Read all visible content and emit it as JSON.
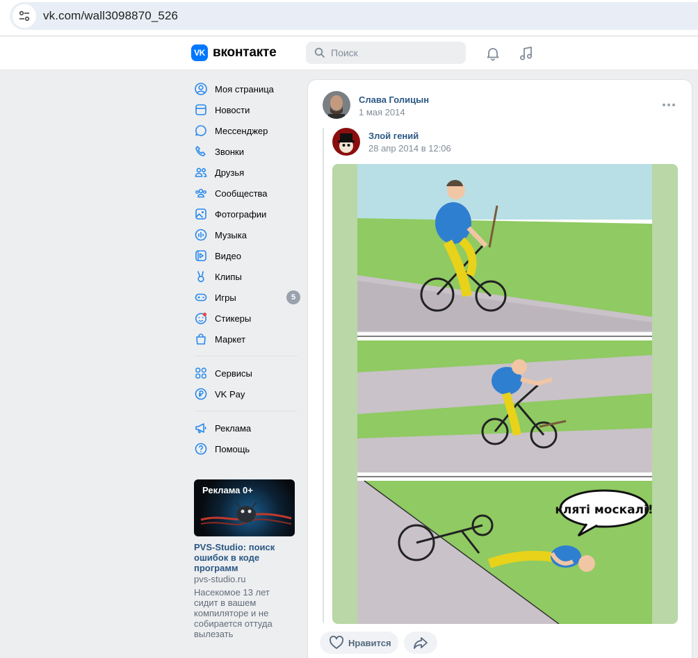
{
  "browser": {
    "url": "vk.com/wall3098870_526"
  },
  "header": {
    "logo_text": "вконтакте",
    "logo_mark": "VK",
    "search_placeholder": "Поиск"
  },
  "nav": {
    "items": [
      {
        "label": "Моя страница",
        "icon": "user-circle-icon"
      },
      {
        "label": "Новости",
        "icon": "news-icon"
      },
      {
        "label": "Мессенджер",
        "icon": "message-icon"
      },
      {
        "label": "Звонки",
        "icon": "phone-icon"
      },
      {
        "label": "Друзья",
        "icon": "friends-icon"
      },
      {
        "label": "Сообщества",
        "icon": "communities-icon"
      },
      {
        "label": "Фотографии",
        "icon": "photo-icon"
      },
      {
        "label": "Музыка",
        "icon": "music-icon"
      },
      {
        "label": "Видео",
        "icon": "video-icon"
      },
      {
        "label": "Клипы",
        "icon": "clips-icon"
      },
      {
        "label": "Игры",
        "icon": "games-icon",
        "badge": "5"
      },
      {
        "label": "Стикеры",
        "icon": "stickers-icon"
      },
      {
        "label": "Маркет",
        "icon": "market-icon"
      }
    ],
    "items2": [
      {
        "label": "Сервисы",
        "icon": "services-icon"
      },
      {
        "label": "VK Pay",
        "icon": "vkpay-icon"
      }
    ],
    "items3": [
      {
        "label": "Реклама",
        "icon": "megaphone-icon"
      },
      {
        "label": "Помощь",
        "icon": "help-icon"
      }
    ]
  },
  "ad": {
    "image_label": "Реклама 0+",
    "title": "PVS-Studio: поиск ошибок в коде программ",
    "domain": "pvs-studio.ru",
    "description": "Насекомое 13 лет сидит в вашем компиляторе и не собирается оттуда вылезать"
  },
  "post": {
    "author": "Слава Голицын",
    "date": "1 мая 2014",
    "repost": {
      "author": "Злой гений",
      "date": "28 апр 2014 в 12:06"
    },
    "comic_caption": "кляті москалі!",
    "like_label": "Нравится"
  },
  "colors": {
    "vk_blue": "#0077ff",
    "link": "#2a5885",
    "background": "#edeef0"
  }
}
